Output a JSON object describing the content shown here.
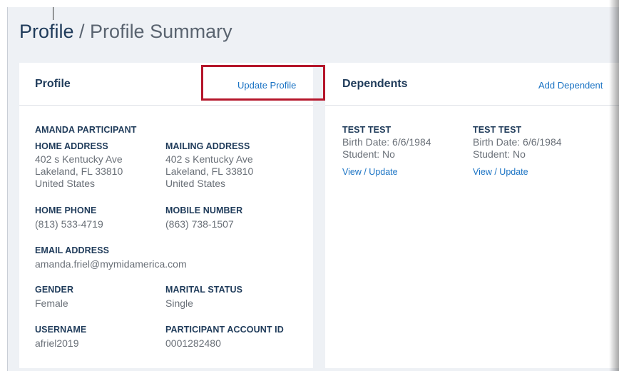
{
  "breadcrumb": {
    "root": "Profile",
    "separator": " / ",
    "current": "Profile Summary"
  },
  "profile_card": {
    "title": "Profile",
    "update_link": "Update Profile",
    "name": "AMANDA PARTICIPANT",
    "home_address": {
      "label": "HOME ADDRESS",
      "line1": "402 s Kentucky Ave",
      "line2": "Lakeland, FL 33810",
      "line3": "United States"
    },
    "mailing_address": {
      "label": "MAILING ADDRESS",
      "line1": "402 s Kentucky Ave",
      "line2": "Lakeland, FL 33810",
      "line3": "United States"
    },
    "home_phone": {
      "label": "HOME PHONE",
      "value": "(813) 533-4719"
    },
    "mobile_number": {
      "label": "MOBILE NUMBER",
      "value": "(863) 738-1507"
    },
    "email": {
      "label": "EMAIL ADDRESS",
      "value": "amanda.friel@mymidamerica.com"
    },
    "gender": {
      "label": "GENDER",
      "value": "Female"
    },
    "marital_status": {
      "label": "MARITAL STATUS",
      "value": "Single"
    },
    "username": {
      "label": "USERNAME",
      "value": "afriel2019"
    },
    "account_id": {
      "label": "PARTICIPANT ACCOUNT ID",
      "value": "0001282480"
    }
  },
  "dependents_card": {
    "title": "Dependents",
    "add_link": "Add Dependent",
    "items": [
      {
        "name": "TEST TEST",
        "birth": "Birth Date: 6/6/1984",
        "student": "Student: No",
        "link": "View / Update"
      },
      {
        "name": "TEST TEST",
        "birth": "Birth Date: 6/6/1984",
        "student": "Student: No",
        "link": "View / Update"
      }
    ]
  },
  "colors": {
    "accent": "#1a73c4",
    "heading": "#1f3b5a",
    "highlight": "#b5162b",
    "background": "#eef1f5"
  }
}
